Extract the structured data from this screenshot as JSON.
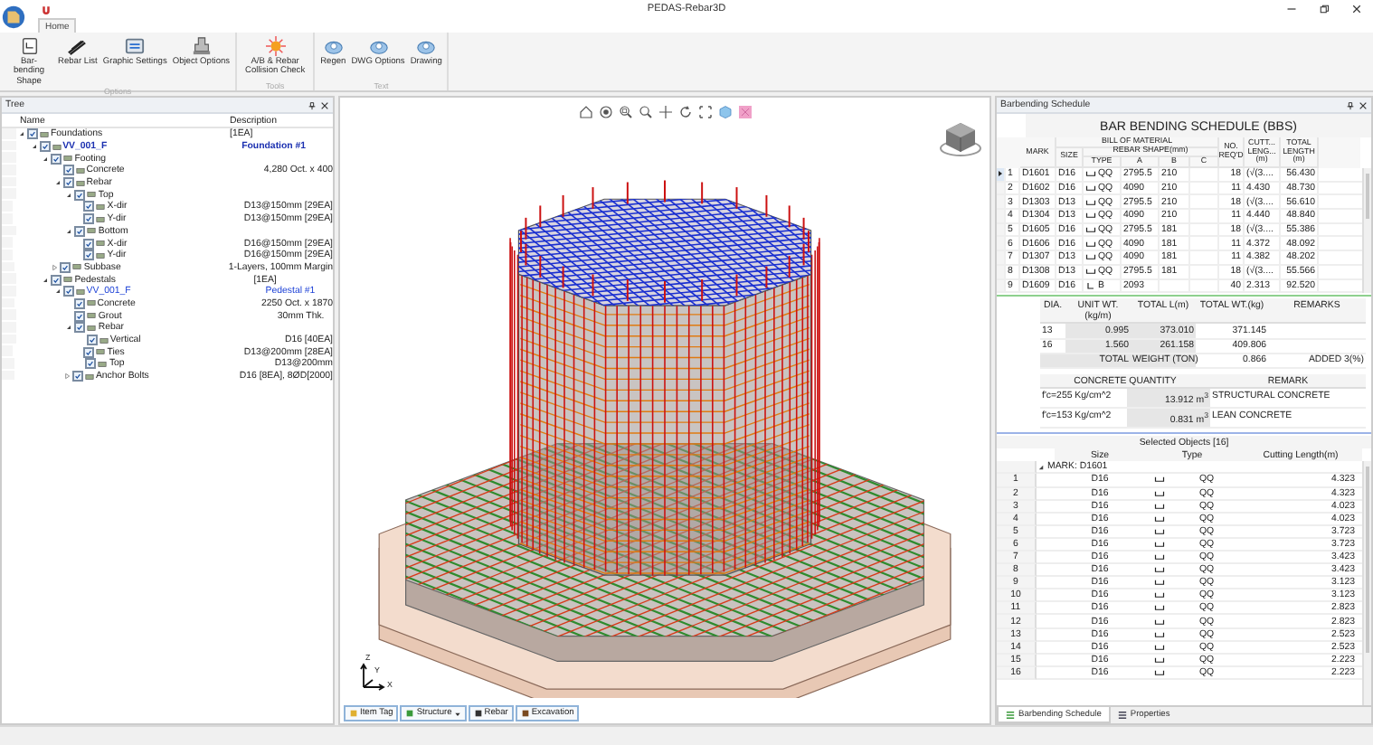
{
  "window": {
    "title": "PEDAS-Rebar3D"
  },
  "ribbon": {
    "tabs": [
      {
        "label": "Home",
        "selected": true
      }
    ],
    "groups": [
      {
        "label": "Options",
        "buttons": [
          {
            "label": "Bar-bending Shape"
          },
          {
            "label": "Rebar List"
          },
          {
            "label": "Graphic Settings"
          },
          {
            "label": "Object Options"
          }
        ]
      },
      {
        "label": "Tools",
        "buttons": [
          {
            "label": "A/B & Rebar Collision Check"
          }
        ]
      },
      {
        "label": "Text",
        "buttons": [
          {
            "label": "Regen"
          },
          {
            "label": "DWG Options"
          },
          {
            "label": "Drawing"
          }
        ]
      }
    ]
  },
  "tree": {
    "title": "Tree",
    "columns": [
      "Name",
      "Description"
    ],
    "items": [
      {
        "name": "Foundations",
        "desc": "[1EA]",
        "checked": true,
        "expanded": true,
        "kind": "item",
        "children": [
          {
            "name": "VV_001_F",
            "desc": "Foundation #1",
            "checked": true,
            "expanded": true,
            "kind": "active-instance",
            "children": [
              {
                "name": "Footing",
                "checked": true,
                "expanded": true,
                "kind": "item",
                "children": [
                  {
                    "name": "Concrete",
                    "desc": "4,280 Oct. x 400",
                    "checked": true,
                    "kind": "item"
                  },
                  {
                    "name": "Rebar",
                    "checked": true,
                    "expanded": true,
                    "kind": "item",
                    "children": [
                      {
                        "name": "Top",
                        "checked": true,
                        "expanded": true,
                        "kind": "item",
                        "children": [
                          {
                            "name": "X-dir",
                            "desc": "D13@150mm [29EA]",
                            "checked": true,
                            "kind": "item"
                          },
                          {
                            "name": "Y-dir",
                            "desc": "D13@150mm [29EA]",
                            "checked": true,
                            "kind": "item"
                          }
                        ]
                      },
                      {
                        "name": "Bottom",
                        "checked": true,
                        "expanded": true,
                        "kind": "item",
                        "children": [
                          {
                            "name": "X-dir",
                            "desc": "D16@150mm [29EA]",
                            "checked": true,
                            "kind": "item"
                          },
                          {
                            "name": "Y-dir",
                            "desc": "D16@150mm [29EA]",
                            "checked": true,
                            "kind": "item"
                          }
                        ]
                      }
                    ]
                  },
                  {
                    "name": "Subbase",
                    "desc": "1-Layers, 100mm Margin",
                    "checked": true,
                    "expanded": false,
                    "kind": "item"
                  }
                ]
              },
              {
                "name": "Pedestals",
                "desc": "[1EA]",
                "checked": true,
                "expanded": true,
                "kind": "item",
                "children": [
                  {
                    "name": "VV_001_F",
                    "desc": "Pedestal #1",
                    "checked": true,
                    "expanded": true,
                    "kind": "instance",
                    "children": [
                      {
                        "name": "Concrete",
                        "desc": "2250 Oct. x 1870",
                        "checked": true,
                        "kind": "item"
                      },
                      {
                        "name": "Grout",
                        "desc": "30mm Thk.",
                        "checked": true,
                        "kind": "item"
                      },
                      {
                        "name": "Rebar",
                        "checked": true,
                        "expanded": true,
                        "kind": "item",
                        "children": [
                          {
                            "name": "Vertical",
                            "desc": "D16 [40EA]",
                            "checked": true,
                            "kind": "item"
                          },
                          {
                            "name": "Ties",
                            "desc": "D13@200mm [28EA]",
                            "checked": true,
                            "kind": "item"
                          },
                          {
                            "name": "Top",
                            "desc": "D13@200mm",
                            "checked": true,
                            "kind": "item"
                          }
                        ]
                      },
                      {
                        "name": "Anchor Bolts",
                        "desc": "D16 [8EA], 8ØD[2000]",
                        "checked": true,
                        "expanded": false,
                        "kind": "item"
                      }
                    ]
                  }
                ]
              }
            ]
          }
        ]
      }
    ]
  },
  "view": {
    "axis_labels": [
      "Z",
      "Y",
      "X"
    ],
    "tabs": [
      {
        "label": "Item Tag",
        "dropdown": false
      },
      {
        "label": "Structure",
        "dropdown": true
      },
      {
        "label": "Rebar",
        "dropdown": false
      },
      {
        "label": "Excavation",
        "dropdown": false
      }
    ]
  },
  "schedule": {
    "panel_title": "Barbending Schedule",
    "title": "BAR BENDING SCHEDULE (BBS)",
    "group_header": "BILL OF MATERIAL",
    "shape_header": "REBAR SHAPE(mm)",
    "columns": [
      "MARK",
      "SIZE",
      "TYPE",
      "A",
      "B",
      "C",
      "NO. REQ'D",
      "CUTT... LENG... (m)",
      "TOTAL LENGTH (m)"
    ],
    "rows": [
      {
        "no": "1",
        "mark": "D1601",
        "size": "D16",
        "kind": "hook",
        "type": "QQ",
        "a": "2795.5",
        "b": "210",
        "c": "",
        "req": "18",
        "cut": "(√(3....",
        "total": "56.430",
        "selected": true
      },
      {
        "no": "2",
        "mark": "D1602",
        "size": "D16",
        "kind": "hook",
        "type": "QQ",
        "a": "4090",
        "b": "210",
        "c": "",
        "req": "11",
        "cut": "4.430",
        "total": "48.730",
        "selected": false
      },
      {
        "no": "3",
        "mark": "D1303",
        "size": "D13",
        "kind": "hook",
        "type": "QQ",
        "a": "2795.5",
        "b": "210",
        "c": "",
        "req": "18",
        "cut": "(√(3....",
        "total": "56.610",
        "selected": false
      },
      {
        "no": "4",
        "mark": "D1304",
        "size": "D13",
        "kind": "hook",
        "type": "QQ",
        "a": "4090",
        "b": "210",
        "c": "",
        "req": "11",
        "cut": "4.440",
        "total": "48.840",
        "selected": false
      },
      {
        "no": "5",
        "mark": "D1605",
        "size": "D16",
        "kind": "hook",
        "type": "QQ",
        "a": "2795.5",
        "b": "181",
        "c": "",
        "req": "18",
        "cut": "(√(3....",
        "total": "55.386",
        "selected": false
      },
      {
        "no": "6",
        "mark": "D1606",
        "size": "D16",
        "kind": "hook",
        "type": "QQ",
        "a": "4090",
        "b": "181",
        "c": "",
        "req": "11",
        "cut": "4.372",
        "total": "48.092",
        "selected": false
      },
      {
        "no": "7",
        "mark": "D1307",
        "size": "D13",
        "kind": "hook",
        "type": "QQ",
        "a": "4090",
        "b": "181",
        "c": "",
        "req": "11",
        "cut": "4.382",
        "total": "48.202",
        "selected": false
      },
      {
        "no": "8",
        "mark": "D1308",
        "size": "D13",
        "kind": "hook",
        "type": "QQ",
        "a": "2795.5",
        "b": "181",
        "c": "",
        "req": "18",
        "cut": "(√(3....",
        "total": "55.566",
        "selected": false
      },
      {
        "no": "9",
        "mark": "D1609",
        "size": "D16",
        "kind": "ell",
        "type": "B",
        "a": "2093",
        "b": "",
        "c": "",
        "req": "40",
        "cut": "2.313",
        "total": "92.520",
        "selected": false
      }
    ],
    "summary": {
      "columns": [
        "DIA.",
        "UNIT WT.(kg/m)",
        "TOTAL L(m)",
        "TOTAL WT.(kg)",
        "REMARKS"
      ],
      "rows": [
        [
          "13",
          "0.995",
          "373.010",
          "371.145",
          ""
        ],
        [
          "16",
          "1.560",
          "261.158",
          "409.806",
          ""
        ]
      ],
      "total": [
        "TOTAL",
        "WEIGHT (TON)",
        "0.866",
        "ADDED 3(%)"
      ]
    },
    "concrete": {
      "columns": [
        "CONCRETE QUANTITY",
        "",
        "REMARK"
      ],
      "rows": [
        [
          "f'c=255 Kg/cm^2",
          "13.912 m$^{3}$",
          "STRUCTURAL CONCRETE"
        ],
        [
          "f'c=153 Kg/cm^2",
          "0.831 m$^{3}$",
          "LEAN CONCRETE"
        ]
      ]
    }
  },
  "selected_objects": {
    "title": "Selected Objects [16]",
    "columns": [
      "Size",
      "Type",
      "Cutting Length(m)"
    ],
    "group": "MARK: D1601",
    "rows": [
      {
        "no": "1",
        "size": "D16",
        "type": "QQ",
        "length": "4.323"
      },
      {
        "no": "2",
        "size": "D16",
        "type": "QQ",
        "length": "4.323"
      },
      {
        "no": "3",
        "size": "D16",
        "type": "QQ",
        "length": "4.023"
      },
      {
        "no": "4",
        "size": "D16",
        "type": "QQ",
        "length": "4.023"
      },
      {
        "no": "5",
        "size": "D16",
        "type": "QQ",
        "length": "3.723"
      },
      {
        "no": "6",
        "size": "D16",
        "type": "QQ",
        "length": "3.723"
      },
      {
        "no": "7",
        "size": "D16",
        "type": "QQ",
        "length": "3.423"
      },
      {
        "no": "8",
        "size": "D16",
        "type": "QQ",
        "length": "3.423"
      },
      {
        "no": "9",
        "size": "D16",
        "type": "QQ",
        "length": "3.123"
      },
      {
        "no": "10",
        "size": "D16",
        "type": "QQ",
        "length": "3.123"
      },
      {
        "no": "11",
        "size": "D16",
        "type": "QQ",
        "length": "2.823"
      },
      {
        "no": "12",
        "size": "D16",
        "type": "QQ",
        "length": "2.823"
      },
      {
        "no": "13",
        "size": "D16",
        "type": "QQ",
        "length": "2.523"
      },
      {
        "no": "14",
        "size": "D16",
        "type": "QQ",
        "length": "2.523"
      },
      {
        "no": "15",
        "size": "D16",
        "type": "QQ",
        "length": "2.223"
      },
      {
        "no": "16",
        "size": "D16",
        "type": "QQ",
        "length": "2.223"
      }
    ]
  },
  "right_tabs": [
    {
      "label": "Barbending Schedule",
      "selected": true
    },
    {
      "label": "Properties",
      "selected": false
    }
  ]
}
